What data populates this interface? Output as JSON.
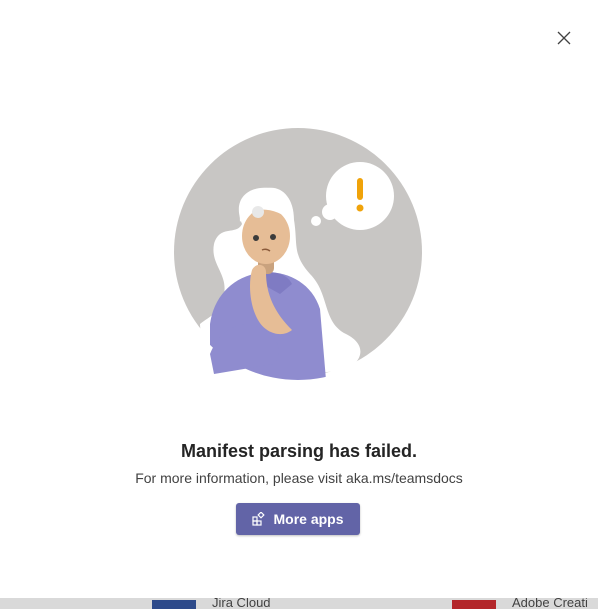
{
  "dialog": {
    "close_label": "Close",
    "title": "Manifest parsing has failed.",
    "message": "For more information, please visit aka.ms/teamsdocs",
    "primary_button": {
      "label": "More apps",
      "icon": "apps-add-icon"
    }
  },
  "background_apps": [
    {
      "name": "Jira Cloud",
      "color": "#2d4a8a"
    },
    {
      "name": "Adobe Creati",
      "color": "#b3262a"
    }
  ],
  "colors": {
    "accent": "#6264a7",
    "illustration_circle": "#c8c6c4",
    "warning": "#f0a30a"
  }
}
